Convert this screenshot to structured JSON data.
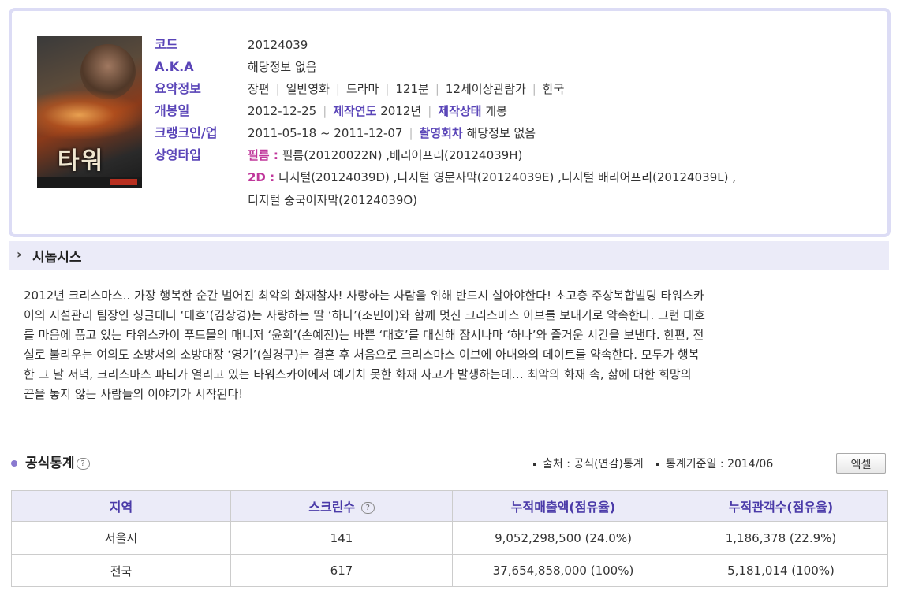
{
  "movie": {
    "poster_title": "타워",
    "rows": [
      {
        "label": "코드",
        "value": "20124039"
      },
      {
        "label": "A.K.A",
        "value": "해당정보 없음"
      },
      {
        "label": "요약정보",
        "items": [
          "장편",
          "일반영화",
          "드라마",
          "121분",
          "12세이상관람가",
          "한국"
        ]
      },
      {
        "label": "개봉일",
        "value": "2012-12-25",
        "sub1_label": "제작연도",
        "sub1_value": "2012년",
        "sub2_label": "제작상태",
        "sub2_value": "개봉"
      },
      {
        "label": "크랭크인/업",
        "value": "2011-05-18 ~ 2011-12-07",
        "sub1_label": "촬영회차",
        "sub1_value": "해당정보 없음"
      },
      {
        "label": "상영타입",
        "film_label": "필름 :",
        "film_value": "필름(20120022N) ,배리어프리(20124039H)",
        "d2_label": "2D :",
        "d2_value": "디지털(20124039D) ,디지털 영문자막(20124039E) ,디지털 배리어프리(20124039L) ,",
        "d2_value2": "디지털 중국어자막(20124039O)"
      }
    ]
  },
  "synopsis": {
    "title": "시놉시스",
    "lines": [
      "2012년 크리스마스.. 가장 행복한 순간 벌어진 최악의 화재참사! 사랑하는 사람을 위해 반드시 살아야한다! 초고층 주상복합빌딩 타워스카",
      "이의 시설관리 팀장인 싱글대디 ‘대호’(김상경)는 사랑하는 딸 ‘하나’(조민아)와 함께 멋진 크리스마스 이브를 보내기로 약속한다. 그런 대호",
      "를 마음에 품고 있는 타워스카이 푸드몰의 매니저 ‘윤희’(손예진)는 바쁜 ‘대호’를 대신해 잠시나마 ‘하나’와 즐거운 시간을 보낸다. 한편, 전",
      "설로 불리우는 여의도 소방서의 소방대장 ‘영기’(설경구)는 결혼 후 처음으로 크리스마스 이브에 아내와의 데이트를 약속한다. 모두가 행복",
      "한 그 날 저녁, 크리스마스 파티가 열리고 있는 타워스카이에서 예기치 못한 화재 사고가 발생하는데… 최악의 화재 속, 삶에 대한 희망의",
      "끈을 놓지 않는 사람들의 이야기가 시작된다!"
    ]
  },
  "stats": {
    "title": "공식통계",
    "source": "출처 : 공식(연감)통계",
    "basis_date": "통계기준일 : 2014/06",
    "excel_label": "엑셀",
    "help_icon_glyph": "?",
    "headers": [
      "지역",
      "스크린수",
      "누적매출액(점유율)",
      "누적관객수(점유율)"
    ],
    "rows": [
      [
        "서울시",
        "141",
        "9,052,298,500 (24.0%)",
        "1,186,378 (22.9%)"
      ],
      [
        "전국",
        "617",
        "37,654,858,000 (100%)",
        "5,181,014 (100%)"
      ]
    ]
  }
}
